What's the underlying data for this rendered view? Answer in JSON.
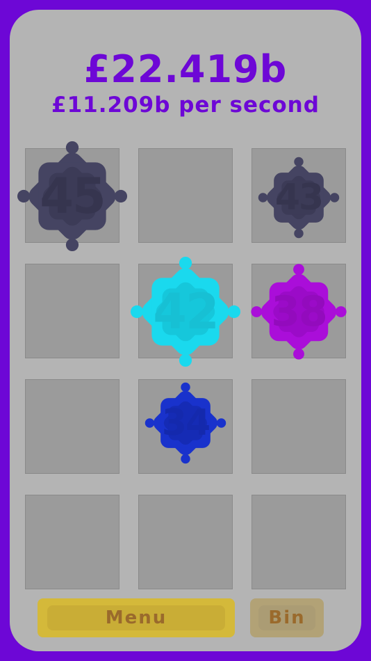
{
  "header": {
    "balance": "£22.419b",
    "rate": "£11.209b per second"
  },
  "grid": {
    "tiles": [
      {
        "label": "45",
        "color": "#454462",
        "inner": "#3c3b57",
        "text": "#36354f"
      },
      {
        "label": "43",
        "color": "#454462",
        "inner": "#3c3b57",
        "text": "#36354f"
      },
      {
        "label": "42",
        "color": "#1ad9ee",
        "inner": "#16c7db",
        "text": "#17c0d4"
      },
      {
        "label": "38",
        "color": "#aa0ed9",
        "inner": "#9b0bc8",
        "text": "#930bbd"
      },
      {
        "label": "34",
        "color": "#1932cc",
        "inner": "#152bb5",
        "text": "#1429ad"
      }
    ]
  },
  "buttons": {
    "menu": "Menu",
    "bin": "Bin"
  },
  "colors": {
    "frame": "#6d07d6",
    "panel": "#b4b4b4",
    "cell": "#9b9b9b",
    "menu_button": "#d4b93a",
    "bin_button": "#b2a276"
  }
}
